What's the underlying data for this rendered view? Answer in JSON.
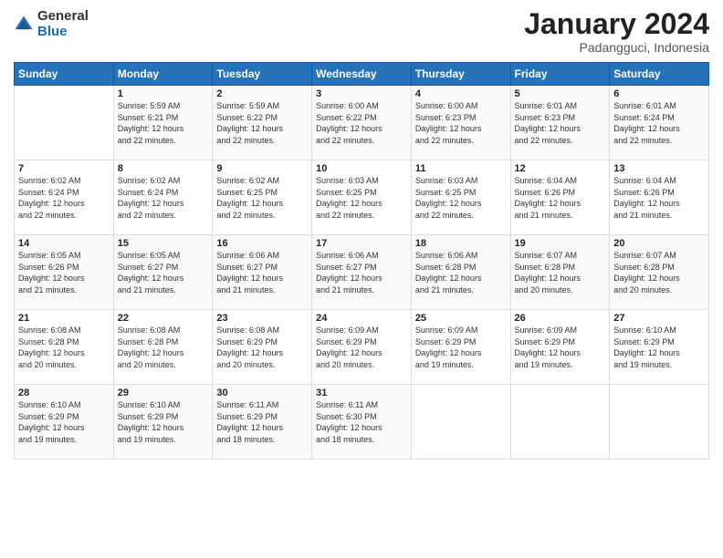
{
  "header": {
    "logo_general": "General",
    "logo_blue": "Blue",
    "month_title": "January 2024",
    "location": "Padangguci, Indonesia"
  },
  "days_of_week": [
    "Sunday",
    "Monday",
    "Tuesday",
    "Wednesday",
    "Thursday",
    "Friday",
    "Saturday"
  ],
  "weeks": [
    [
      {
        "day": "",
        "info": ""
      },
      {
        "day": "1",
        "info": "Sunrise: 5:59 AM\nSunset: 6:21 PM\nDaylight: 12 hours\nand 22 minutes."
      },
      {
        "day": "2",
        "info": "Sunrise: 5:59 AM\nSunset: 6:22 PM\nDaylight: 12 hours\nand 22 minutes."
      },
      {
        "day": "3",
        "info": "Sunrise: 6:00 AM\nSunset: 6:22 PM\nDaylight: 12 hours\nand 22 minutes."
      },
      {
        "day": "4",
        "info": "Sunrise: 6:00 AM\nSunset: 6:23 PM\nDaylight: 12 hours\nand 22 minutes."
      },
      {
        "day": "5",
        "info": "Sunrise: 6:01 AM\nSunset: 6:23 PM\nDaylight: 12 hours\nand 22 minutes."
      },
      {
        "day": "6",
        "info": "Sunrise: 6:01 AM\nSunset: 6:24 PM\nDaylight: 12 hours\nand 22 minutes."
      }
    ],
    [
      {
        "day": "7",
        "info": "Sunrise: 6:02 AM\nSunset: 6:24 PM\nDaylight: 12 hours\nand 22 minutes."
      },
      {
        "day": "8",
        "info": "Sunrise: 6:02 AM\nSunset: 6:24 PM\nDaylight: 12 hours\nand 22 minutes."
      },
      {
        "day": "9",
        "info": "Sunrise: 6:02 AM\nSunset: 6:25 PM\nDaylight: 12 hours\nand 22 minutes."
      },
      {
        "day": "10",
        "info": "Sunrise: 6:03 AM\nSunset: 6:25 PM\nDaylight: 12 hours\nand 22 minutes."
      },
      {
        "day": "11",
        "info": "Sunrise: 6:03 AM\nSunset: 6:25 PM\nDaylight: 12 hours\nand 22 minutes."
      },
      {
        "day": "12",
        "info": "Sunrise: 6:04 AM\nSunset: 6:26 PM\nDaylight: 12 hours\nand 21 minutes."
      },
      {
        "day": "13",
        "info": "Sunrise: 6:04 AM\nSunset: 6:26 PM\nDaylight: 12 hours\nand 21 minutes."
      }
    ],
    [
      {
        "day": "14",
        "info": "Sunrise: 6:05 AM\nSunset: 6:26 PM\nDaylight: 12 hours\nand 21 minutes."
      },
      {
        "day": "15",
        "info": "Sunrise: 6:05 AM\nSunset: 6:27 PM\nDaylight: 12 hours\nand 21 minutes."
      },
      {
        "day": "16",
        "info": "Sunrise: 6:06 AM\nSunset: 6:27 PM\nDaylight: 12 hours\nand 21 minutes."
      },
      {
        "day": "17",
        "info": "Sunrise: 6:06 AM\nSunset: 6:27 PM\nDaylight: 12 hours\nand 21 minutes."
      },
      {
        "day": "18",
        "info": "Sunrise: 6:06 AM\nSunset: 6:28 PM\nDaylight: 12 hours\nand 21 minutes."
      },
      {
        "day": "19",
        "info": "Sunrise: 6:07 AM\nSunset: 6:28 PM\nDaylight: 12 hours\nand 20 minutes."
      },
      {
        "day": "20",
        "info": "Sunrise: 6:07 AM\nSunset: 6:28 PM\nDaylight: 12 hours\nand 20 minutes."
      }
    ],
    [
      {
        "day": "21",
        "info": "Sunrise: 6:08 AM\nSunset: 6:28 PM\nDaylight: 12 hours\nand 20 minutes."
      },
      {
        "day": "22",
        "info": "Sunrise: 6:08 AM\nSunset: 6:28 PM\nDaylight: 12 hours\nand 20 minutes."
      },
      {
        "day": "23",
        "info": "Sunrise: 6:08 AM\nSunset: 6:29 PM\nDaylight: 12 hours\nand 20 minutes."
      },
      {
        "day": "24",
        "info": "Sunrise: 6:09 AM\nSunset: 6:29 PM\nDaylight: 12 hours\nand 20 minutes."
      },
      {
        "day": "25",
        "info": "Sunrise: 6:09 AM\nSunset: 6:29 PM\nDaylight: 12 hours\nand 19 minutes."
      },
      {
        "day": "26",
        "info": "Sunrise: 6:09 AM\nSunset: 6:29 PM\nDaylight: 12 hours\nand 19 minutes."
      },
      {
        "day": "27",
        "info": "Sunrise: 6:10 AM\nSunset: 6:29 PM\nDaylight: 12 hours\nand 19 minutes."
      }
    ],
    [
      {
        "day": "28",
        "info": "Sunrise: 6:10 AM\nSunset: 6:29 PM\nDaylight: 12 hours\nand 19 minutes."
      },
      {
        "day": "29",
        "info": "Sunrise: 6:10 AM\nSunset: 6:29 PM\nDaylight: 12 hours\nand 19 minutes."
      },
      {
        "day": "30",
        "info": "Sunrise: 6:11 AM\nSunset: 6:29 PM\nDaylight: 12 hours\nand 18 minutes."
      },
      {
        "day": "31",
        "info": "Sunrise: 6:11 AM\nSunset: 6:30 PM\nDaylight: 12 hours\nand 18 minutes."
      },
      {
        "day": "",
        "info": ""
      },
      {
        "day": "",
        "info": ""
      },
      {
        "day": "",
        "info": ""
      }
    ]
  ]
}
